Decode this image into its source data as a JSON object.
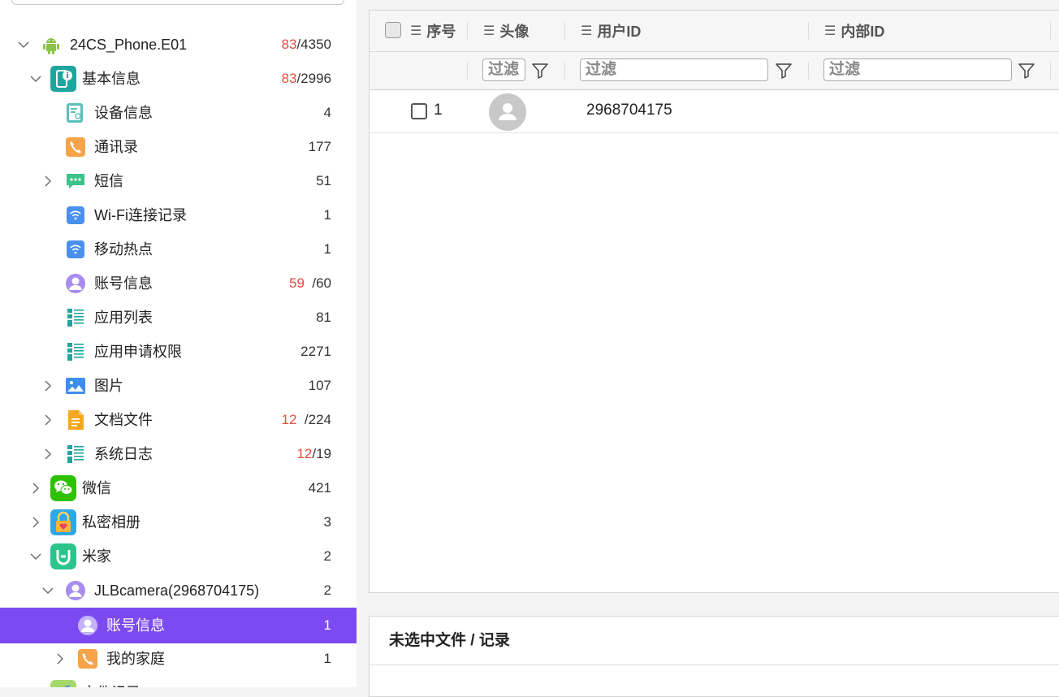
{
  "tree": {
    "root": {
      "label": "24CS_Phone.E01",
      "count_red": "83",
      "count_total": "/4350"
    },
    "basic": {
      "label": "基本信息",
      "count_red": "83",
      "count_total": "/2996"
    },
    "device_info": {
      "label": "设备信息",
      "count": "4"
    },
    "contacts": {
      "label": "通讯录",
      "count": "177"
    },
    "sms": {
      "label": "短信",
      "count": "51"
    },
    "wifi": {
      "label": "Wi-Fi连接记录",
      "count": "1"
    },
    "hotspot": {
      "label": "移动热点",
      "count": "1"
    },
    "account": {
      "label": "账号信息",
      "count_red": "59",
      "count_total": "/60"
    },
    "apps": {
      "label": "应用列表",
      "count": "81"
    },
    "permissions": {
      "label": "应用申请权限",
      "count": "2271"
    },
    "pictures": {
      "label": "图片",
      "count": "107"
    },
    "documents": {
      "label": "文档文件",
      "count_red": "12",
      "count_total": "/224"
    },
    "syslog": {
      "label": "系统日志",
      "count_red": "12",
      "count_total": "/19"
    },
    "wechat": {
      "label": "微信",
      "count": "421"
    },
    "private_album": {
      "label": "私密相册",
      "count": "3"
    },
    "mijia": {
      "label": "米家",
      "count": "2"
    },
    "jlb": {
      "label": "JLBcamera(2968704175)",
      "count": "2"
    },
    "jlb_account": {
      "label": "账号信息",
      "count": "1"
    },
    "my_home": {
      "label": "我的家庭",
      "count": "1"
    },
    "next_partial": {
      "label": "文件记录"
    }
  },
  "grid": {
    "columns": {
      "index": "序号",
      "avatar": "头像",
      "user_id": "用户ID",
      "internal_id": "内部ID"
    },
    "filter_placeholder": "过滤",
    "rows": [
      {
        "index": "1",
        "user_id": "2968704175"
      }
    ]
  },
  "detail": {
    "title": "未选中文件 / 记录"
  },
  "colors": {
    "selected": "#7d4af1",
    "red_count": "#e74c3c",
    "android_green": "#8bc34a"
  }
}
